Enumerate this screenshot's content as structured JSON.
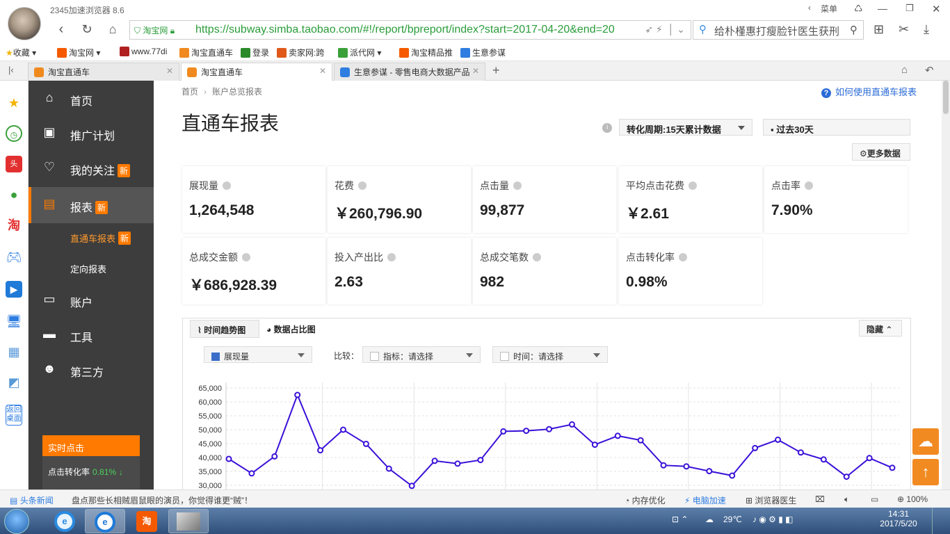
{
  "browser": {
    "title": "2345加速浏览器 8.6",
    "menu_label": "菜单",
    "secure_label": "淘宝网",
    "url": "https://subway.simba.taobao.com/#!/report/bpreport/index?start=2017-04-20&end=20",
    "search_text": "给朴槿惠打瘦脸针医生获刑"
  },
  "favorites": [
    {
      "label": "收藏",
      "icon": "star-icon",
      "color": "#f4b400"
    },
    {
      "label": "淘宝网",
      "icon": "taobao-icon",
      "color": "#f55a00"
    },
    {
      "label": "www.77di",
      "icon": "site-icon",
      "color": "#b02020"
    },
    {
      "label": "淘宝直通车",
      "icon": "ztc-icon",
      "color": "#f08a1f"
    },
    {
      "label": "登录",
      "icon": "login-icon",
      "color": "#2a8a2a"
    },
    {
      "label": "卖家网:跨",
      "icon": "maijia-icon",
      "color": "#e0591a"
    },
    {
      "label": "派代网",
      "icon": "paidai-icon",
      "color": "#3aa03a"
    },
    {
      "label": "淘宝精品推",
      "icon": "taobao-icon",
      "color": "#f55a00"
    },
    {
      "label": "生意参谋",
      "icon": "sycm-icon",
      "color": "#2e7de0"
    }
  ],
  "tabs": [
    {
      "label": "淘宝直通车",
      "icon_color": "#f08a1f"
    },
    {
      "label": "淘宝直通车",
      "icon_color": "#f08a1f"
    },
    {
      "label": "生意参谋 - 零售电商大数据产品",
      "icon_color": "#2e7de0"
    }
  ],
  "sidenav": {
    "items": [
      {
        "label": "首页",
        "icon": "home-icon"
      },
      {
        "label": "推广计划",
        "icon": "bag-icon"
      },
      {
        "label": "我的关注",
        "icon": "heart-icon",
        "badge": "新"
      },
      {
        "label": "报表",
        "icon": "report-icon",
        "badge": "新"
      },
      {
        "label": "账户",
        "icon": "account-icon"
      },
      {
        "label": "工具",
        "icon": "toolbox-icon"
      },
      {
        "label": "第三方",
        "icon": "thirdparty-icon"
      }
    ],
    "sub_items": [
      {
        "label": "直通车报表",
        "badge": "新"
      },
      {
        "label": "定向报表"
      }
    ],
    "realtime": {
      "title": "实时点击",
      "label": "点击转化率",
      "value": "0.81%"
    }
  },
  "main": {
    "breadcrumb": [
      "首页",
      "账户总览报表"
    ],
    "help_link": "如何使用直通车报表",
    "title": "直通车报表",
    "period_select": "转化周期:15天累计数据",
    "date_select": "过去30天",
    "more_data": "更多数据",
    "metrics_row1": [
      {
        "label": "展现量",
        "value": "1,264,548"
      },
      {
        "label": "花费",
        "value": "￥260,796.90"
      },
      {
        "label": "点击量",
        "value": "99,877"
      },
      {
        "label": "平均点击花费",
        "value": "￥2.61"
      },
      {
        "label": "点击率",
        "value": "7.90%"
      }
    ],
    "metrics_row2": [
      {
        "label": "总成交金额",
        "value": "￥686,928.39"
      },
      {
        "label": "投入产出比",
        "value": "2.63"
      },
      {
        "label": "总成交笔数",
        "value": "982"
      },
      {
        "label": "点击转化率",
        "value": "0.98%"
      }
    ],
    "chart_tabs": [
      "时间趋势图",
      "数据占比图"
    ],
    "hide_label": "隐藏",
    "metric_select": "展现量",
    "compare_label": "比较：",
    "indicator_select": "指标：请选择",
    "time_select": "时间：请选择"
  },
  "chart_data": {
    "type": "line",
    "series": [
      {
        "values": [
          39500,
          34300,
          40400,
          62500,
          42600,
          50000,
          44900,
          36000,
          29800,
          38800,
          37800,
          39100,
          49400,
          49600,
          50200,
          51900,
          44600,
          47800,
          46200,
          37200,
          36800,
          35100,
          33500,
          43400,
          46400,
          41800,
          39300,
          33100,
          39800,
          36300
        ]
      }
    ],
    "y_ticks": [
      "65,000",
      "60,000",
      "55,000",
      "50,000",
      "45,000",
      "40,000",
      "35,000",
      "30,000"
    ],
    "ylim": [
      30000,
      65000
    ],
    "grid": true,
    "line_color": "#3a10d8"
  },
  "statusbar": {
    "news_label": "头条新闻",
    "news_text": "盘点那些长相贼眉鼠眼的演员，你觉得谁更“贼”！",
    "memory": "内存优化",
    "speedup": "电脑加速",
    "doctor": "浏览器医生",
    "zoom": "100%"
  },
  "taskbar": {
    "temp": "29℃",
    "time": "14:31",
    "date": "2017/5/20"
  }
}
